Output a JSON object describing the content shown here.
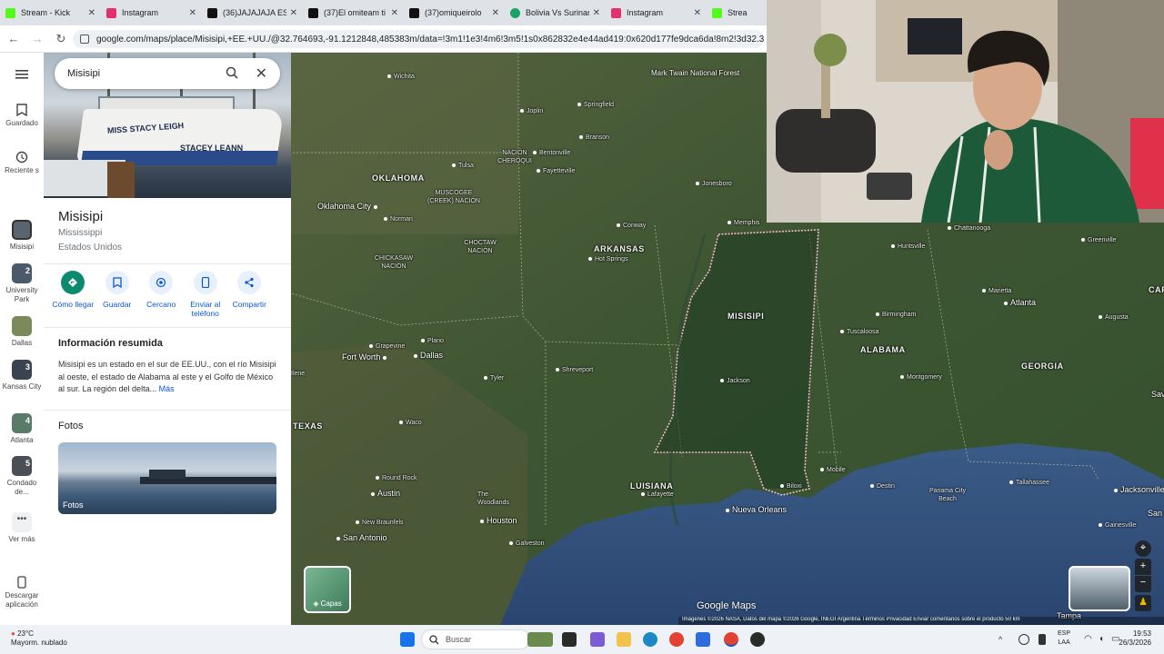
{
  "browser": {
    "tabs": [
      {
        "label": "Stream - Kick",
        "color": "#53fc18"
      },
      {
        "label": "Instagram",
        "color": "#e1306c"
      },
      {
        "label": "(36)JAJAJAJA ES",
        "color": "#111111"
      },
      {
        "label": "(37)El omiteam ti",
        "color": "#111111"
      },
      {
        "label": "(37)omiqueirolo",
        "color": "#111111"
      },
      {
        "label": "Bolivia Vs Surinam",
        "color": "#1aa260"
      },
      {
        "label": "Instagram",
        "color": "#e1306c"
      },
      {
        "label": "Strea",
        "color": "#53fc18"
      }
    ],
    "url": "google.com/maps/place/Misisipi,+EE.+UU./@32.764693,-91.1212848,485383m/data=!3m1!1e3!4m6!3m5!1s0x862832e4e44ad419:0x620d177fe9dca6da!8m2!3d32.3546679!4d-89."
  },
  "rail": {
    "menu_icon": "hamburger-icon",
    "items": [
      {
        "label": "Guardado",
        "icon": "bookmark-icon"
      },
      {
        "label": "Reciente s",
        "icon": "history-icon"
      },
      {
        "label": "Misisipi",
        "thumb": "#5a6470"
      },
      {
        "label": "University Park",
        "num": "2",
        "thumb": "#4a5a6a"
      },
      {
        "label": "Dallas",
        "thumb": "#7a8a5a"
      },
      {
        "label": "Kansas City",
        "num": "3",
        "thumb": "#3a4450"
      },
      {
        "label": "Atlanta",
        "num": "4",
        "thumb": "#5a7a6a"
      },
      {
        "label": "Condado de...",
        "num": "5",
        "thumb": "#4a4f55"
      },
      {
        "label": "Ver más",
        "icon": "more-icon"
      },
      {
        "label": "Descargar aplicación",
        "icon": "phone-icon"
      }
    ]
  },
  "panel": {
    "search_value": "Misisipi",
    "title": "Misisipi",
    "subtitle": "Mississippi",
    "country": "Estados Unidos",
    "actions": [
      {
        "label": "Cómo llegar",
        "icon": "directions-icon"
      },
      {
        "label": "Guardar",
        "icon": "bookmark-icon"
      },
      {
        "label": "Cercano",
        "icon": "nearby-icon"
      },
      {
        "label": "Enviar al teléfono",
        "icon": "send-to-phone-icon"
      },
      {
        "label": "Compartir",
        "icon": "share-icon"
      }
    ],
    "summary_heading": "Información resumida",
    "summary_text": "Misisipi es un estado en el sur de EE.UU., con el río Misisipi al oeste, el estado de Alabama al este y el Golfo de México al sur. La región del delta...",
    "summary_more": "Más",
    "photos_heading": "Fotos",
    "photos_label": "Fotos",
    "boat_names": [
      "MISS STACY LEIGH",
      "STACEY LEANN"
    ]
  },
  "map": {
    "states": [
      {
        "name": "OKLAHOMA"
      },
      {
        "name": "ARKANSAS"
      },
      {
        "name": "MISISIPI"
      },
      {
        "name": "ALABAMA"
      },
      {
        "name": "GEORGIA"
      },
      {
        "name": "TEXAS"
      },
      {
        "name": "LUISIANA"
      },
      {
        "name": "CAR"
      }
    ],
    "nations": [
      "NACIÓN CHEROQUI",
      "MUSCOGEE (CREEK) NACIÓN",
      "CHOCTAW NACIÓN",
      "CHICKASAW NACIÓN"
    ],
    "forest": "Mark Twain National Forest",
    "cities": [
      "Wichita",
      "Joplin",
      "Springfield",
      "Branson",
      "Bentonville",
      "Fayetteville",
      "Tulsa",
      "Oklahoma City",
      "Norman",
      "Jonesboro",
      "Memphis",
      "Conway",
      "Hot Springs",
      "Plano",
      "Grapevine",
      "Dallas",
      "Fort Worth",
      "Shreveport",
      "Tyler",
      "Waco",
      "Jackson",
      "Huntsville",
      "Birmingham",
      "Tuscaloosa",
      "Montgomery",
      "Chattanooga",
      "Greenville",
      "Marietta",
      "Atlanta",
      "Augusta",
      "Mobile",
      "Biloxi",
      "Destin",
      "Panama City Beach",
      "Tallahassee",
      "Jacksonville",
      "Gainesville",
      "San A",
      "Sav",
      "Tampa",
      "Round Rock",
      "Austin",
      "The Woodlands",
      "Houston",
      "New Braunfels",
      "San Antonio",
      "Galveston",
      "Lafayette",
      "Nueva Orleans",
      "Ilene"
    ],
    "layers_label": "Capas",
    "brand": "Google Maps",
    "attribution": "Imágenes ©2026 NASA, Datos del mapa ©2026 Google, INEGI    Argentina    Términos    Privacidad    Enviar comentarios sobre el producto    50 km"
  },
  "taskbar": {
    "weather_temp": "23°C",
    "weather_desc": "Mayorm. nublado",
    "search_placeholder": "Buscar",
    "lang1": "ESP",
    "lang2": "LAA",
    "time": "19:53",
    "date": "26/3/2026"
  }
}
